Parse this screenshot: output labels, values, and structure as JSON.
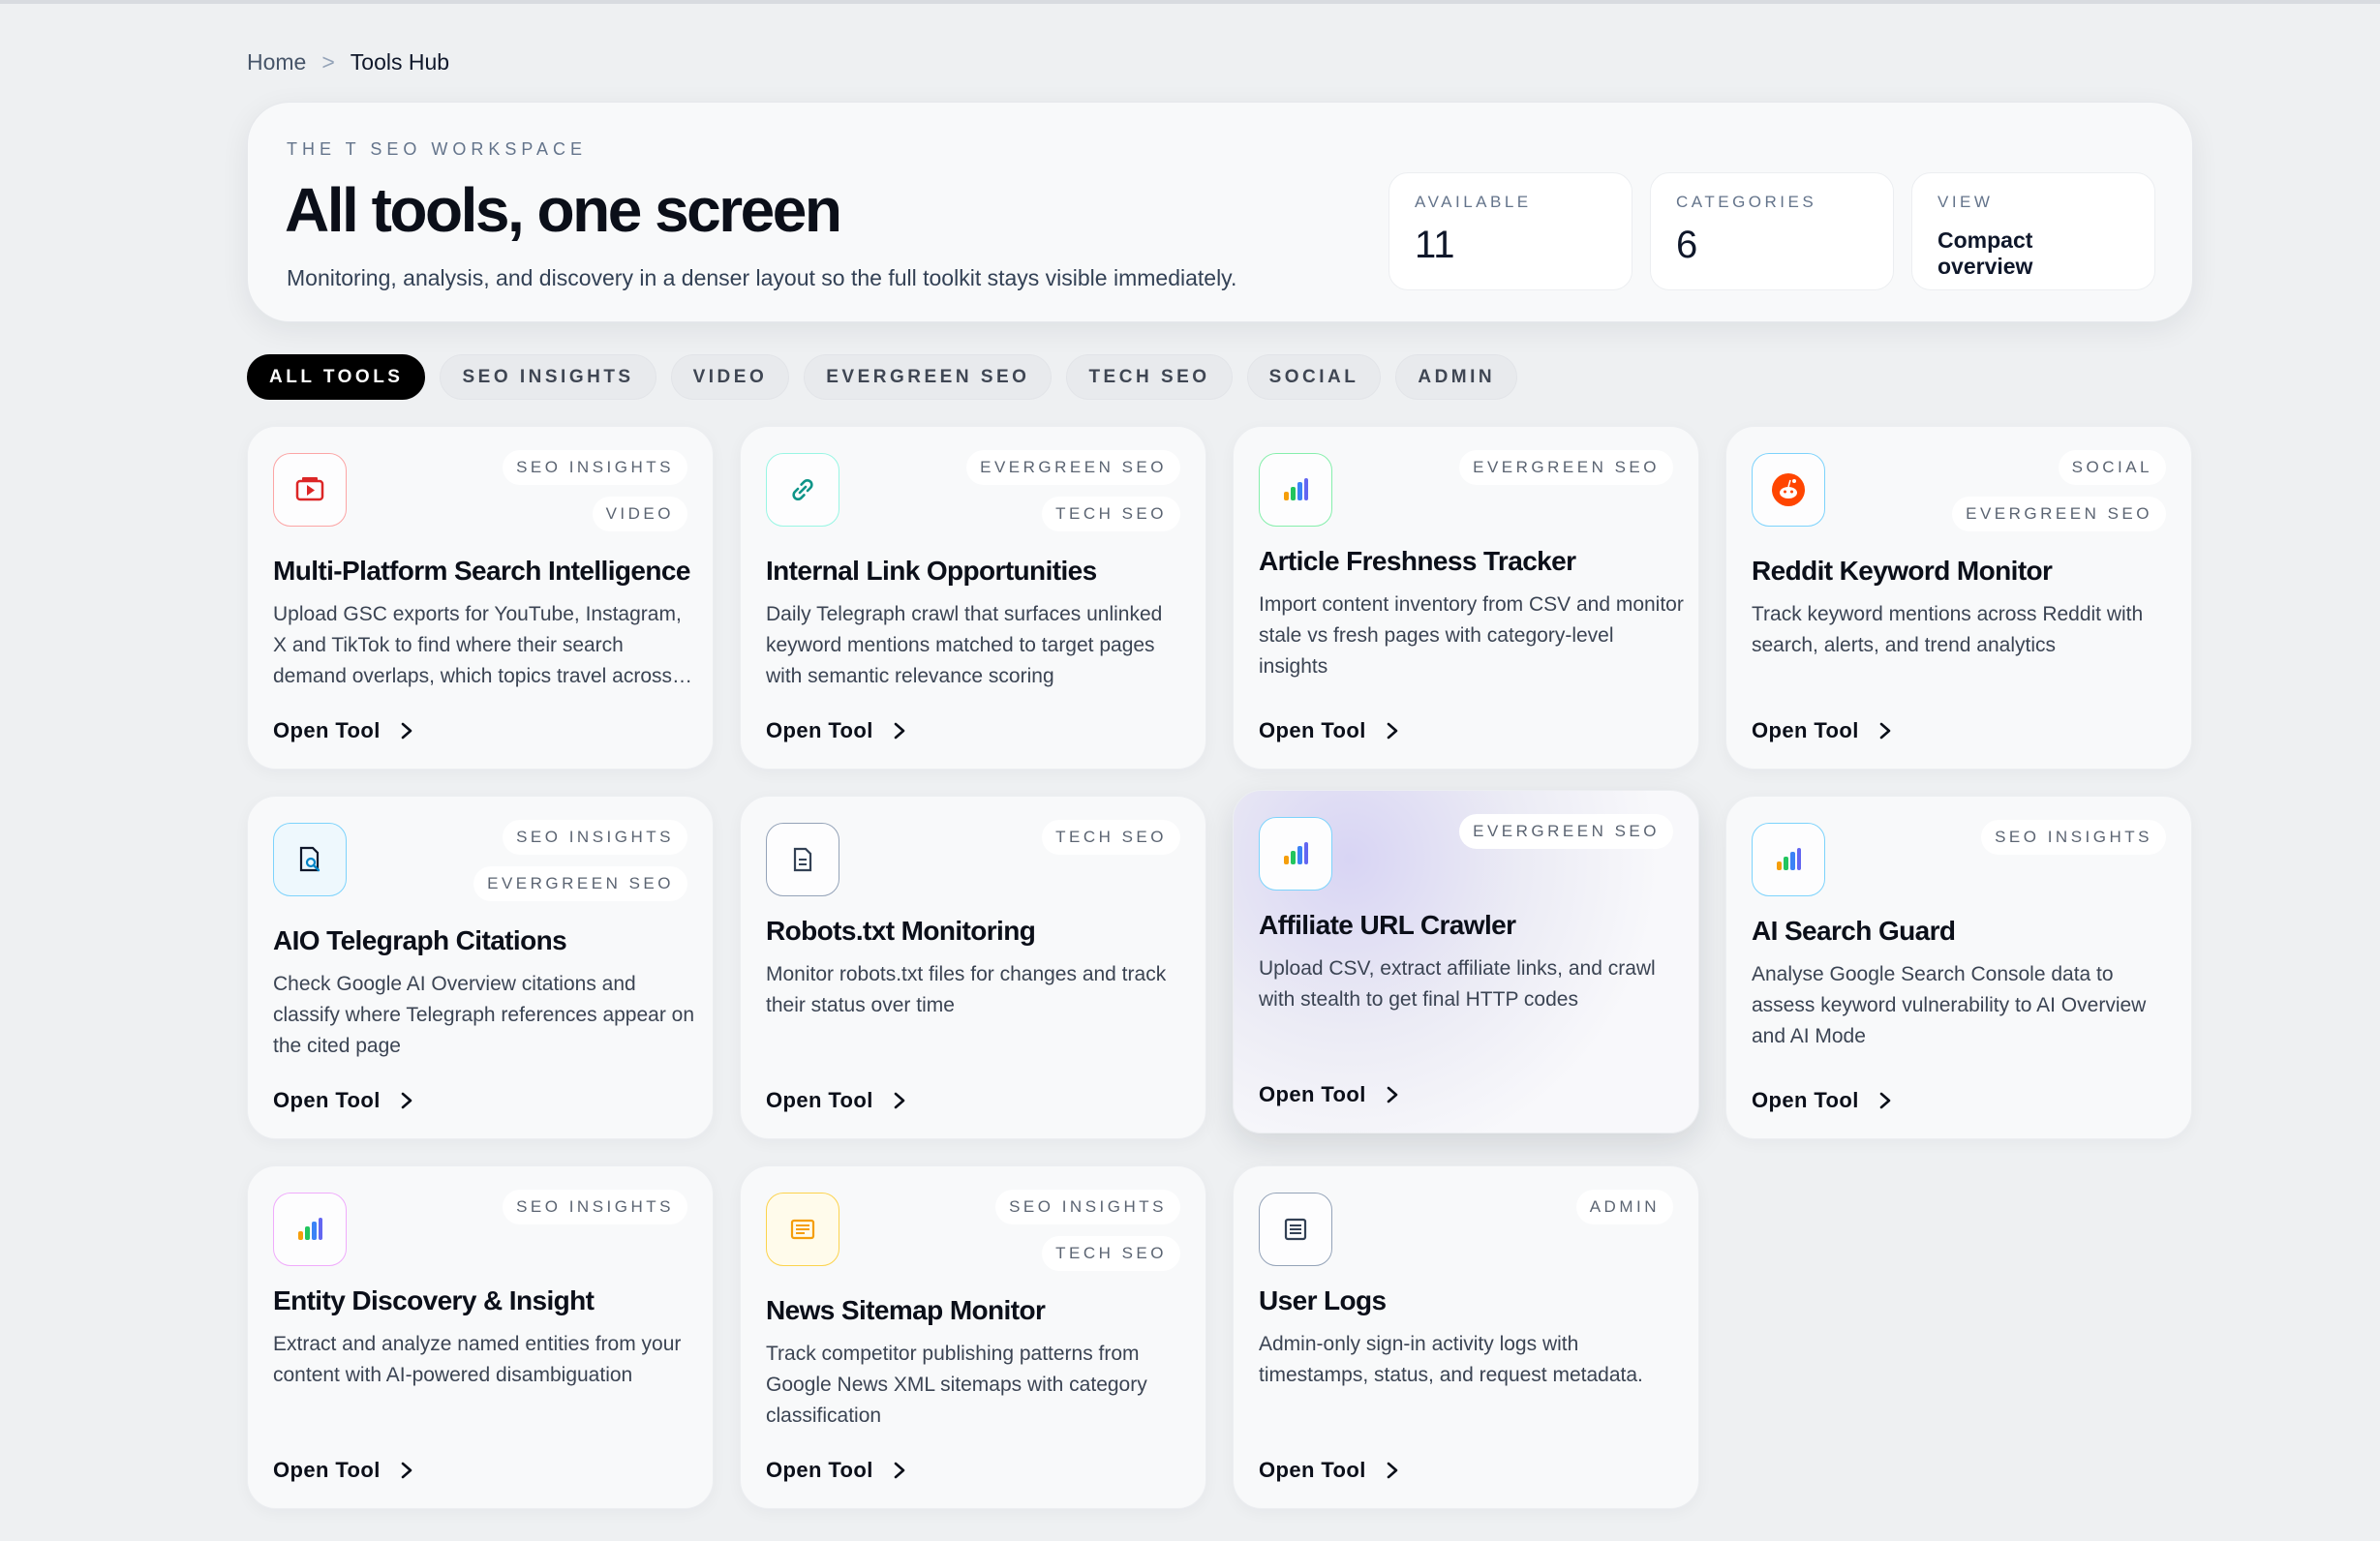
{
  "breadcrumb": {
    "home": "Home",
    "separator": ">",
    "current": "Tools Hub"
  },
  "hero": {
    "eyebrow": "THE T SEO WORKSPACE",
    "title": "All tools, one screen",
    "subtitle": "Monitoring, analysis, and discovery in a denser layout so the full toolkit stays visible immediately.",
    "stats": {
      "available": {
        "label": "AVAILABLE",
        "value": "11"
      },
      "categories": {
        "label": "CATEGORIES",
        "value": "6"
      },
      "view": {
        "label": "VIEW",
        "value": "Compact overview"
      }
    }
  },
  "filters": [
    "ALL TOOLS",
    "SEO INSIGHTS",
    "VIDEO",
    "EVERGREEN SEO",
    "TECH SEO",
    "SOCIAL",
    "ADMIN"
  ],
  "open_label": "Open Tool",
  "tools": [
    {
      "name": "Multi-Platform Search Intelligence",
      "tags": [
        "SEO INSIGHTS",
        "VIDEO"
      ],
      "icon": "youtube-tv-icon",
      "accent": "#dc2626",
      "description": "Upload GSC exports for YouTube, Instagram, X and TikTok to find where their search demand overlaps, which topics travel across platforms"
    },
    {
      "name": "Internal Link Opportunities",
      "tags": [
        "EVERGREEN SEO",
        "TECH SEO"
      ],
      "icon": "link-icon",
      "accent": "#0d9488",
      "description": "Daily Telegraph crawl that surfaces unlinked keyword mentions matched to target pages with semantic relevance scoring"
    },
    {
      "name": "Article Freshness Tracker",
      "tags": [
        "EVERGREEN SEO"
      ],
      "icon": "bar-chart-icon",
      "accent": "#16a34a",
      "description": "Import content inventory from CSV and monitor stale vs fresh pages with category-level insights"
    },
    {
      "name": "Reddit Keyword Monitor",
      "tags": [
        "SOCIAL",
        "EVERGREEN SEO"
      ],
      "icon": "reddit-icon",
      "accent": "#0ea5e9",
      "description": "Track keyword mentions across Reddit with search, alerts, and trend analytics"
    },
    {
      "name": "AIO Telegraph Citations",
      "tags": [
        "SEO INSIGHTS",
        "EVERGREEN SEO"
      ],
      "icon": "document-search-icon",
      "accent": "#0ea5e9",
      "description": "Check Google AI Overview citations and classify where Telegraph references appear on the cited page"
    },
    {
      "name": "Robots.txt Monitoring",
      "tags": [
        "TECH SEO"
      ],
      "icon": "document-icon",
      "accent": "#475569",
      "description": "Monitor robots.txt files for changes and track their status over time"
    },
    {
      "name": "Affiliate URL Crawler",
      "tags": [
        "EVERGREEN SEO"
      ],
      "icon": "bar-chart-icon",
      "accent": "#0ea5e9",
      "description": "Upload CSV, extract affiliate links, and crawl with stealth to get final HTTP codes"
    },
    {
      "name": "AI Search Guard",
      "tags": [
        "SEO INSIGHTS"
      ],
      "icon": "bar-chart-icon",
      "accent": "#0ea5e9",
      "description": "Analyse Google Search Console data to assess keyword vulnerability to AI Overview and AI Mode"
    },
    {
      "name": "Entity Discovery & Insight",
      "tags": [
        "SEO INSIGHTS"
      ],
      "icon": "bar-chart-icon",
      "accent": "#db2777",
      "description": "Extract and analyze named entities from your content with AI-powered disambiguation"
    },
    {
      "name": "News Sitemap Monitor",
      "tags": [
        "SEO INSIGHTS",
        "TECH SEO"
      ],
      "icon": "news-icon",
      "accent": "#f59e0b",
      "description": "Track competitor publishing patterns from Google News XML sitemaps with category classification"
    },
    {
      "name": "User Logs",
      "tags": [
        "ADMIN"
      ],
      "icon": "log-list-icon",
      "accent": "#334155",
      "description": "Admin-only sign-in activity logs with timestamps, status, and request metadata."
    }
  ]
}
